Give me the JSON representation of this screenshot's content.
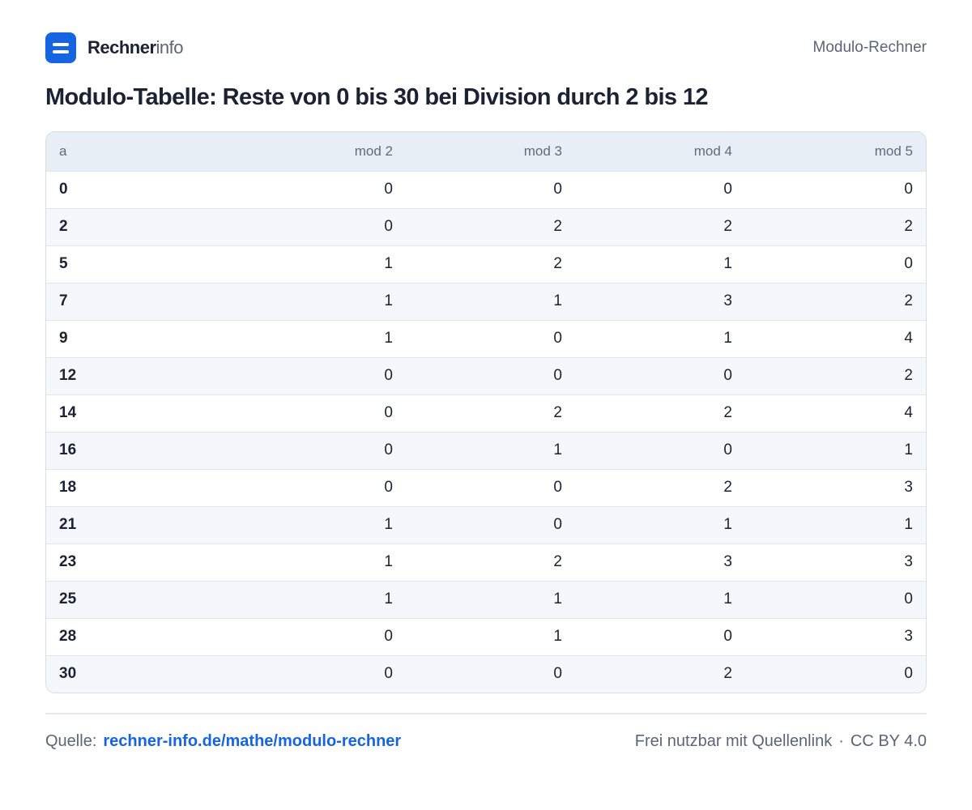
{
  "header": {
    "brand_strong": "Rechner",
    "brand_light": "info",
    "page_name": "Modulo-Rechner"
  },
  "title": "Modulo-Tabelle:  Reste von 0 bis 30 bei Division durch 2 bis 12",
  "table": {
    "columns": [
      "a",
      "mod 2",
      "mod 3",
      "mod 4",
      "mod 5"
    ],
    "rows": [
      [
        "0",
        "0",
        "0",
        "0",
        "0"
      ],
      [
        "2",
        "0",
        "2",
        "2",
        "2"
      ],
      [
        "5",
        "1",
        "2",
        "1",
        "0"
      ],
      [
        "7",
        "1",
        "1",
        "3",
        "2"
      ],
      [
        "9",
        "1",
        "0",
        "1",
        "4"
      ],
      [
        "12",
        "0",
        "0",
        "0",
        "2"
      ],
      [
        "14",
        "0",
        "2",
        "2",
        "4"
      ],
      [
        "16",
        "0",
        "1",
        "0",
        "1"
      ],
      [
        "18",
        "0",
        "0",
        "2",
        "3"
      ],
      [
        "21",
        "1",
        "0",
        "1",
        "1"
      ],
      [
        "23",
        "1",
        "2",
        "3",
        "3"
      ],
      [
        "25",
        "1",
        "1",
        "1",
        "0"
      ],
      [
        "28",
        "0",
        "1",
        "0",
        "3"
      ],
      [
        "30",
        "0",
        "0",
        "2",
        "0"
      ]
    ]
  },
  "footer": {
    "source_label": "Quelle:",
    "source_link": "rechner-info.de/mathe/modulo-rechner",
    "license_text": "Frei nutzbar mit Quellenlink",
    "separator": "·",
    "license": "CC BY 4.0"
  },
  "colors": {
    "accent": "#1565e0",
    "text": "#1a2233",
    "muted": "#5a6577",
    "header_bg": "#e8eef6",
    "stripe": "#f4f7fb"
  }
}
